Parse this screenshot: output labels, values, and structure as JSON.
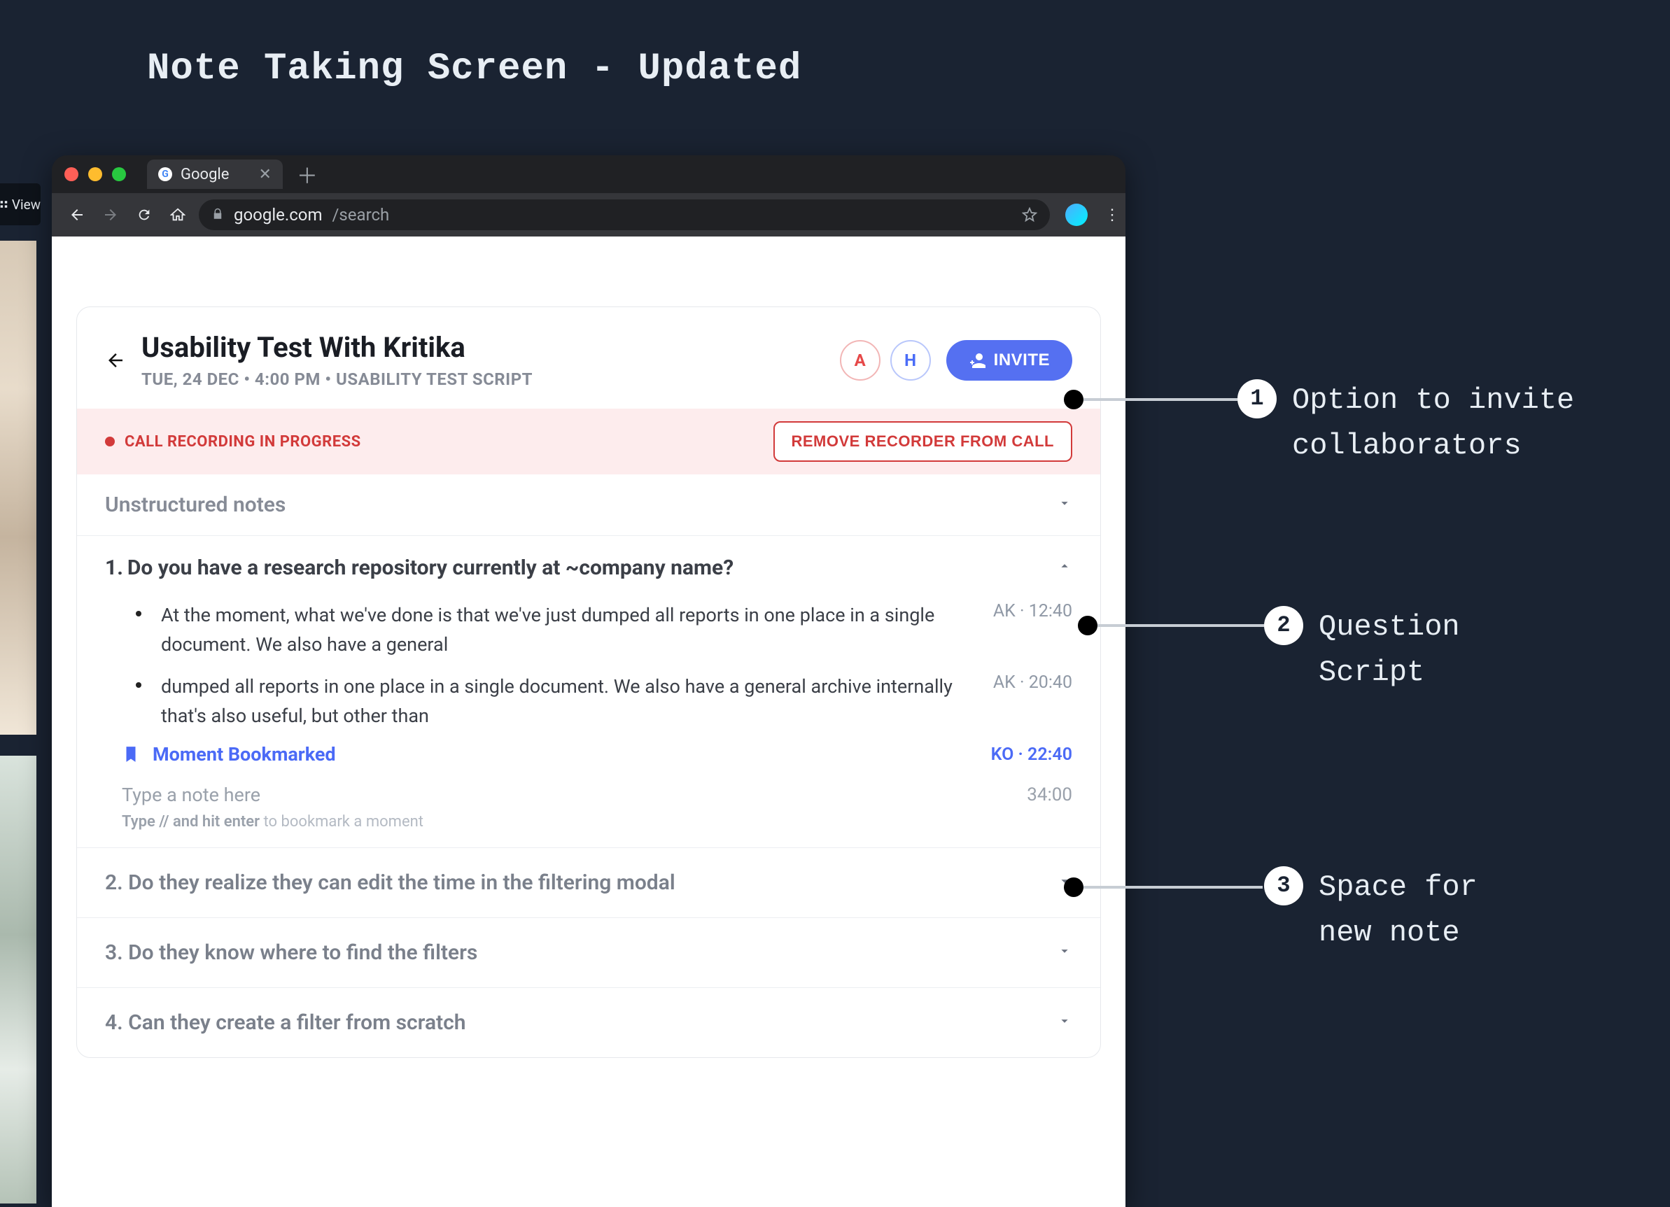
{
  "slide_title": "Note Taking Screen - Updated",
  "left_strip_label": "View",
  "browser": {
    "tab_title": "Google",
    "url_host": "google.com",
    "url_path": "/search"
  },
  "card": {
    "title": "Usability Test With Kritika",
    "subtitle": "TUE, 24 DEC • 4:00 PM • USABILITY TEST SCRIPT",
    "people": [
      {
        "initial": "A",
        "variant": "a"
      },
      {
        "initial": "H",
        "variant": "h"
      }
    ],
    "invite_label": "INVITE",
    "recording_label": "CALL RECORDING IN PROGRESS",
    "remove_recorder_label": "REMOVE RECORDER  FROM CALL",
    "unstructured_label": "Unstructured notes"
  },
  "questions": [
    {
      "num": "1.",
      "text": "Do you have a research repository currently at ~company name?",
      "expanded": true,
      "notes": [
        {
          "text": "At the moment, what we've done is that we've just dumped all reports in one place in a single document. We also have a general",
          "meta": "AK · 12:40"
        },
        {
          "text": "dumped all reports in one place in a single document. We also have a general archive internally that's also useful, but other than",
          "meta": "AK · 20:40"
        }
      ],
      "bookmark": {
        "label": "Moment Bookmarked",
        "meta": "KO · 22:40"
      },
      "new_note": {
        "placeholder": "Type a note here",
        "time": "34:00",
        "hint_strong": "Type // and hit enter",
        "hint_rest": " to bookmark a moment"
      }
    },
    {
      "num": "2.",
      "text": "Do they realize they can edit the time in the filtering modal",
      "expanded": false
    },
    {
      "num": "3.",
      "text": "Do they know where to find the filters",
      "expanded": false
    },
    {
      "num": "4.",
      "text": "Can they create a filter from scratch",
      "expanded": false
    }
  ],
  "annotations": [
    {
      "n": "1",
      "text": "Option to invite collaborators"
    },
    {
      "n": "2",
      "text": "Question Script"
    },
    {
      "n": "3",
      "text": "Space for new note"
    }
  ]
}
